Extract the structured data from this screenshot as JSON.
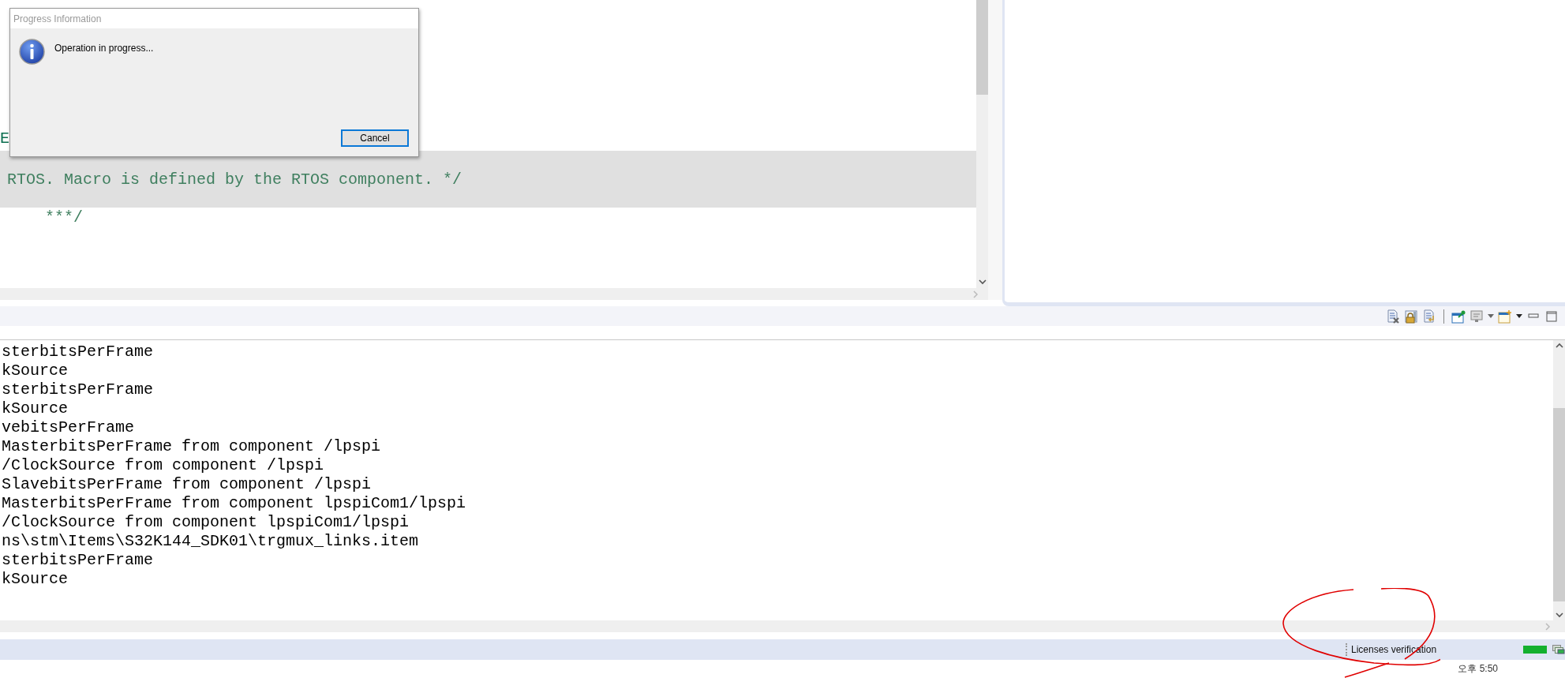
{
  "editor": {
    "lines": [
      {
        "text": "E",
        "highlighted": false,
        "kind": "keyword"
      },
      {
        "text": "RTOS. Macro is defined by the RTOS component. */",
        "highlighted": true,
        "kind": "comment"
      },
      {
        "text": "***/",
        "highlighted": false,
        "kind": "comment"
      }
    ]
  },
  "dialog": {
    "title": "Progress Information",
    "message": "Operation in progress...",
    "button": "Cancel"
  },
  "console": {
    "lines": [
      "sterbitsPerFrame",
      "kSource",
      "sterbitsPerFrame",
      "kSource",
      "vebitsPerFrame",
      "MasterbitsPerFrame from component /lpspi",
      "/ClockSource from component /lpspi",
      "SlavebitsPerFrame from component /lpspi",
      "MasterbitsPerFrame from component lpspiCom1/lpspi",
      "/ClockSource from component lpspiCom1/lpspi",
      "ns\\stm\\Items\\S32K144_SDK01\\trgmux_links.item",
      "sterbitsPerFrame",
      "kSource"
    ]
  },
  "status_bar": {
    "task": "Licenses verification",
    "progress": {
      "level": 1
    }
  },
  "clock": "오후 5:50"
}
